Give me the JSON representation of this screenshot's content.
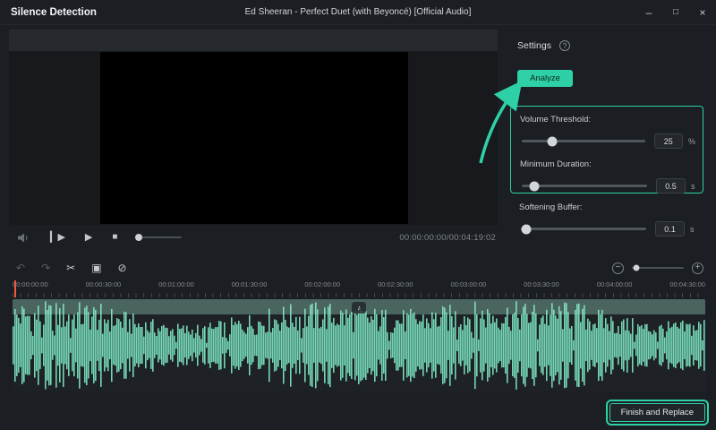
{
  "colors": {
    "accent": "#2ed1a7",
    "waveform": "#74d6b6",
    "playhead": "#f05a3a"
  },
  "titlebar": {
    "app_title": "Silence Detection",
    "media_title": "Ed Sheeran - Perfect Duet (with Beyoncé) [Official Audio]"
  },
  "player": {
    "timecode": "00:00:00:00/00:04:19:02"
  },
  "settings_panel": {
    "heading": "Settings",
    "analyze_label": "Analyze",
    "params": {
      "volume_threshold": {
        "label": "Volume Threshold:",
        "value": "25",
        "unit": "%"
      },
      "minimum_duration": {
        "label": "Minimum Duration:",
        "value": "0.5",
        "unit": "s"
      },
      "softening_buffer": {
        "label": "Softening Buffer:",
        "value": "0.1",
        "unit": "s"
      }
    }
  },
  "timeline": {
    "ruler_labels": [
      "00:00:00:00",
      "00:00:30:00",
      "00:01:00:00",
      "00:01:30:00",
      "00:02:00:00",
      "00:02:30:00",
      "00:03:00:00",
      "00:03:30:00",
      "00:04:00:00",
      "00:04:30:00"
    ]
  },
  "footer": {
    "finish_label": "Finish and Replace"
  },
  "icons": {
    "minimize": "–",
    "maximize": "□",
    "close": "×",
    "step_play": "▎▶",
    "play": "▶",
    "stop": "■",
    "undo": "↶",
    "redo": "↷",
    "split": "✂",
    "crop": "▣",
    "mute": "⊘",
    "zoom_out": "−",
    "zoom_in": "+",
    "help": "?",
    "audio_badge": "♪"
  }
}
